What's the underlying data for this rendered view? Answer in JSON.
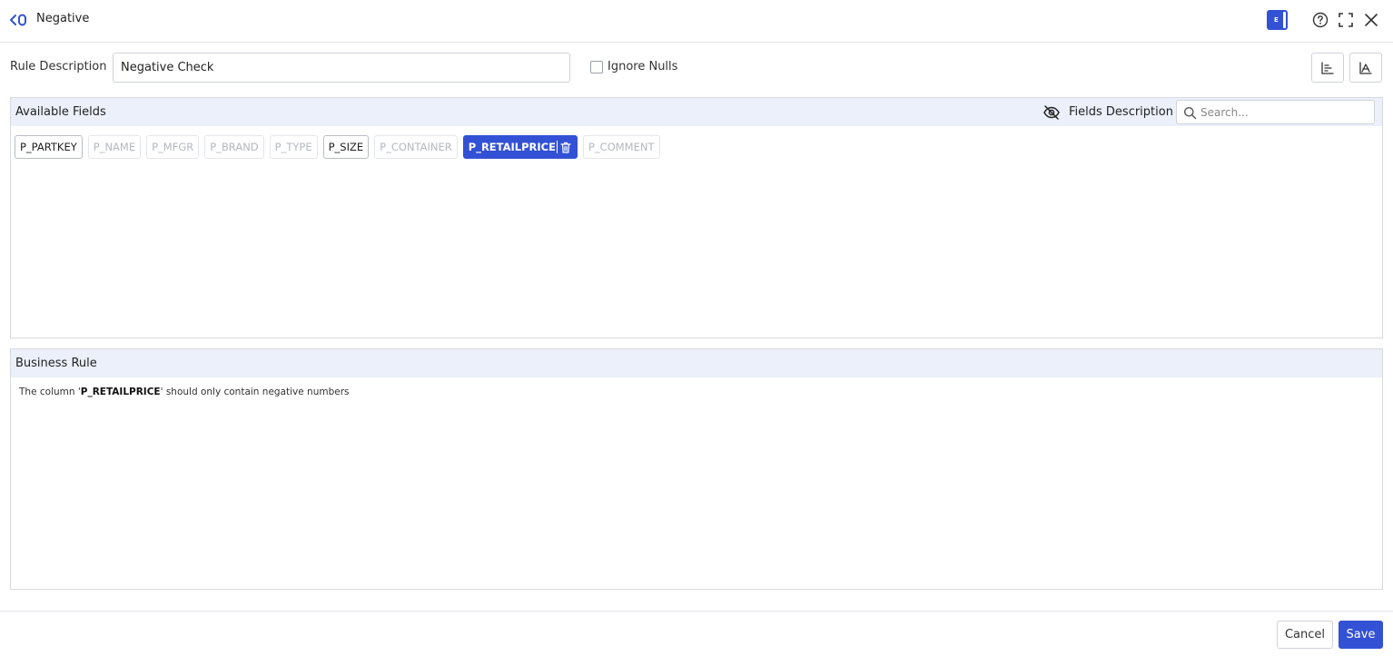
{
  "header": {
    "title": "Negative",
    "badge_label": "E",
    "icons": [
      "back-logo-icon",
      "help-icon",
      "fullscreen-icon",
      "close-icon"
    ]
  },
  "rule_description": {
    "label": "Rule Description",
    "value": "Negative Check",
    "ignore_nulls_label": "Ignore Nulls",
    "ignore_nulls_checked": false
  },
  "available_fields": {
    "title": "Available Fields",
    "fields_description_label": "Fields Description",
    "search_placeholder": "Search...",
    "fields": [
      {
        "label": "P_PARTKEY",
        "state": "active"
      },
      {
        "label": "P_NAME",
        "state": "disabled"
      },
      {
        "label": "P_MFGR",
        "state": "disabled"
      },
      {
        "label": "P_BRAND",
        "state": "disabled"
      },
      {
        "label": "P_TYPE",
        "state": "disabled"
      },
      {
        "label": "P_SIZE",
        "state": "active"
      },
      {
        "label": "P_CONTAINER",
        "state": "disabled"
      },
      {
        "label": "P_RETAILPRICE",
        "state": "selected"
      },
      {
        "label": "P_COMMENT",
        "state": "disabled"
      }
    ]
  },
  "business_rule": {
    "title": "Business Rule",
    "text_before": "The column '",
    "column": "P_RETAILPRICE",
    "text_after": "' should only contain negative numbers"
  },
  "footer": {
    "cancel_label": "Cancel",
    "save_label": "Save"
  },
  "colors": {
    "accent": "#3351d4",
    "panel_header_bg": "#ebf0fa"
  }
}
